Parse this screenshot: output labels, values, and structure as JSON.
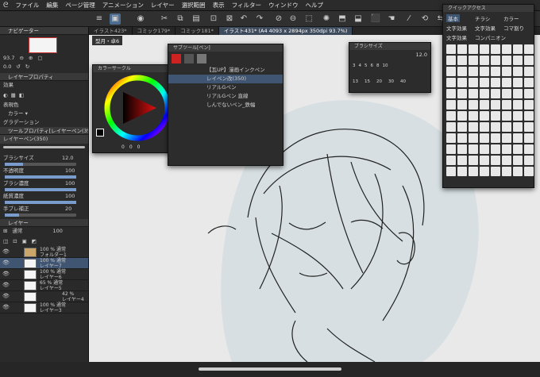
{
  "menu": [
    "ファイル",
    "編集",
    "ページ管理",
    "アニメーション",
    "レイヤー",
    "選択範囲",
    "表示",
    "フィルター",
    "ウィンドウ",
    "ヘルプ"
  ],
  "tabs": [
    "イラスト423*",
    "コミック179*",
    "コミック181*",
    "イラスト431* (A4 4093 x 2894px 350dpi 93.7%)"
  ],
  "subtab": "型月・卓6",
  "navigator": {
    "title": "ナビゲーター",
    "zoom": "93.7",
    "rotate": "0.0"
  },
  "props": {
    "title": "レイヤープロパティ",
    "effect": "効果",
    "color_label": "表現色",
    "color_value": "カラー",
    "gradation": "グラデーション"
  },
  "tool_props": {
    "title": "ツールプロパティ[レイヤーペン(350)]",
    "brush_name": "レイヤーペン(350)",
    "brush_size_label": "ブラシサイズ",
    "brush_size": "12.0",
    "opacity_label": "不透明度",
    "opacity": "100",
    "density_label": "ブラシ濃度",
    "density": "100",
    "paper_label": "紙質濃度",
    "paper": "100",
    "correction_label": "手ブレ補正",
    "correction": "20"
  },
  "layers": {
    "title": "レイヤー",
    "blend": "通常",
    "opacity": "100",
    "rows": [
      {
        "name": "フォルダー1",
        "mode": "100 % 通常"
      },
      {
        "name": "レイヤー7",
        "mode": "100 % 通常"
      },
      {
        "name": "レイヤー6",
        "mode": "100 % 通常"
      },
      {
        "name": "レイヤー5",
        "mode": "65 % 通常"
      },
      {
        "name": "レイヤー4",
        "mode": "42 %"
      },
      {
        "name": "レイヤー3",
        "mode": "100 % 通常"
      }
    ]
  },
  "color_circle": {
    "title": "カラーサークル",
    "h": "0",
    "s": "0",
    "v": "0"
  },
  "subtool": {
    "title": "サブツール[ペン]",
    "items": [
      "【瓦UP】漫画インクペン",
      "レイペン改(350)",
      "リアルGペン",
      "リアルGペン 直線",
      "しんでないペン_鉄幅"
    ]
  },
  "brush_size": {
    "title": "ブラシサイズ",
    "value": "12.0",
    "sizes": [
      "3",
      "4",
      "5",
      "6",
      "8",
      "10",
      "13",
      "15",
      "20",
      "30",
      "40"
    ]
  },
  "quick": {
    "title": "クイックアクセス",
    "tabs": [
      "基本",
      "チラシ",
      "カラー",
      "文字効果",
      "文字効果",
      "コマ割り",
      "文字効果",
      "コンパニオン"
    ]
  },
  "colors": {
    "accent": "#4b6b8f",
    "panel": "#2a2a2a",
    "canvas_bg": "#e9e9e9"
  }
}
